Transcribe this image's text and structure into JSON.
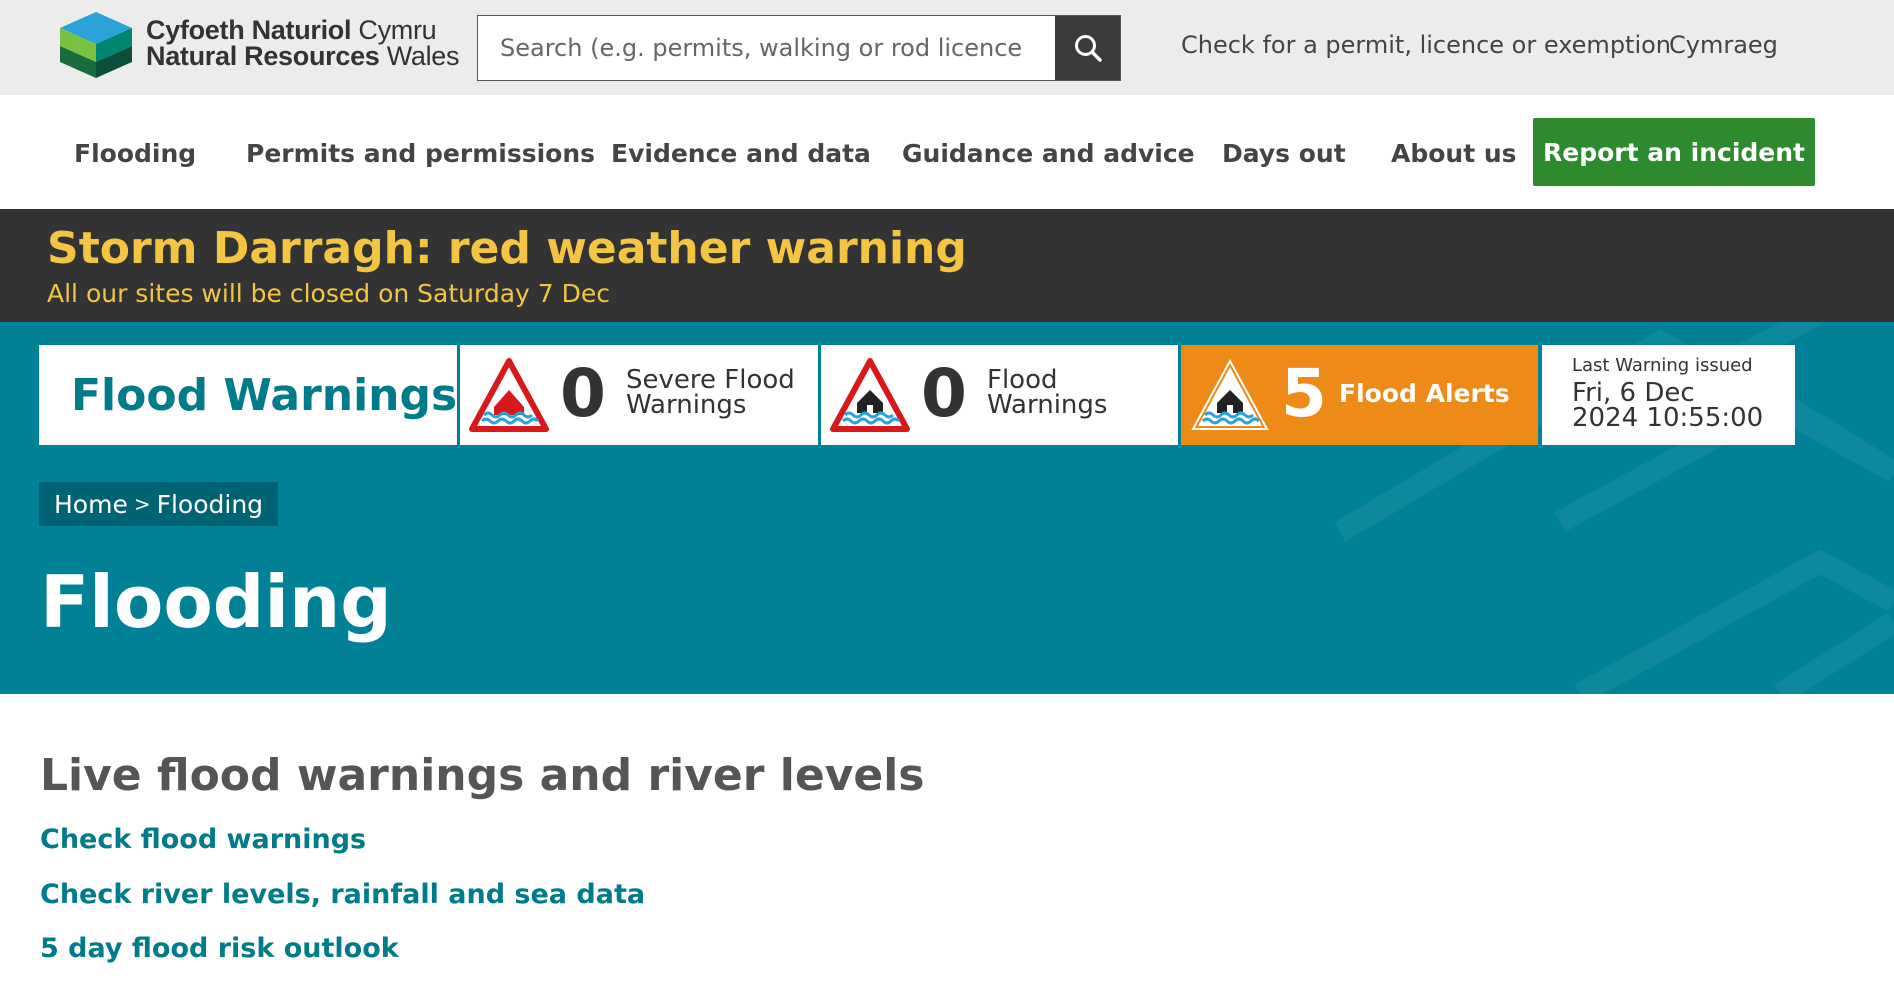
{
  "header": {
    "logo_line1_bold": "Cyfoeth Naturiol",
    "logo_line1_regular": "Cymru",
    "logo_line2_bold": "Natural Resources",
    "logo_line2_regular": "Wales",
    "search_placeholder": "Search (e.g. permits, walking or rod licence",
    "search_icon": "search-icon",
    "link_permit": "Check for a permit, licence or exemption",
    "link_language": "Cymraeg"
  },
  "nav": {
    "items": [
      "Flooding",
      "Permits and permissions",
      "Evidence and data",
      "Guidance and advice",
      "Days out",
      "About us"
    ],
    "report_button": "Report an incident",
    "report_color": "#2e8a2f"
  },
  "storm_banner": {
    "title": "Storm Darragh: red weather warning",
    "subtitle": "All our sites will be closed on Saturday 7 Dec",
    "text_color": "#f4c542"
  },
  "flood_panel": {
    "title": "Flood Warnings",
    "severe": {
      "count": "0",
      "label_line1": "Severe Flood",
      "label_line2": "Warnings",
      "icon": "severe-flood-warning-icon"
    },
    "warnings": {
      "count": "0",
      "label_line1": "Flood",
      "label_line2": "Warnings",
      "icon": "flood-warning-icon"
    },
    "alerts": {
      "count": "5",
      "label": "Flood Alerts",
      "icon": "flood-alert-icon",
      "color": "#ee8a17"
    },
    "last_issued_label": "Last Warning issued",
    "last_issued_line1": "Fri, 6 Dec",
    "last_issued_line2": "2024 10:55:00"
  },
  "breadcrumb": {
    "home": "Home",
    "separator": ">",
    "current": "Flooding"
  },
  "page_title": "Flooding",
  "content": {
    "heading": "Live flood warnings and river levels",
    "links": [
      "Check flood warnings",
      "Check river levels, rainfall and sea data",
      "5 day flood risk outlook"
    ]
  },
  "colors": {
    "teal": "#008196",
    "dark_banner": "#333333"
  }
}
